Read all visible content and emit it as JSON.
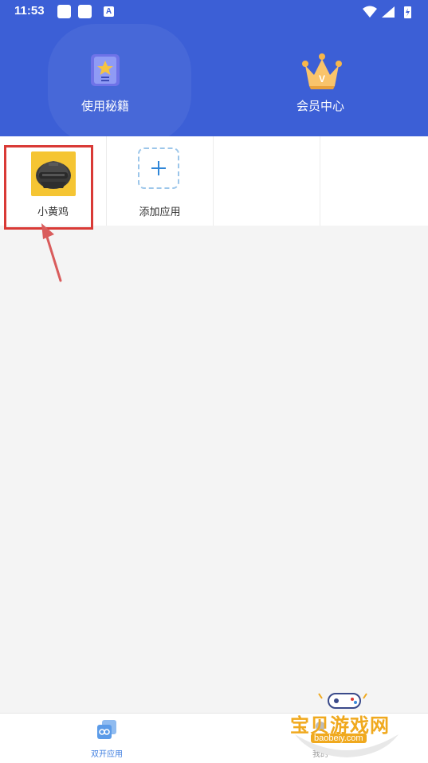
{
  "status_bar": {
    "time": "11:53",
    "notif_letter": "A"
  },
  "header": {
    "items": [
      {
        "label": "使用秘籍",
        "icon": "book-star-icon"
      },
      {
        "label": "会员中心",
        "icon": "crown-icon",
        "badge": "V"
      }
    ]
  },
  "apps": [
    {
      "label": "小黄鸡",
      "icon": "helmet-app-icon"
    },
    {
      "label": "添加应用",
      "icon": "plus-icon"
    }
  ],
  "bottom_nav": {
    "items": [
      {
        "label": "双开应用",
        "icon": "dual-app-icon"
      },
      {
        "label": "我的",
        "icon": "profile-icon"
      }
    ]
  },
  "watermark": {
    "title": "宝贝游戏网",
    "url": "baobeiy.com"
  },
  "colors": {
    "header_bg": "#3c5fd6",
    "highlight": "#d93a36",
    "accent": "#3f7ee0",
    "app_icon_bg": "#f5c533"
  }
}
